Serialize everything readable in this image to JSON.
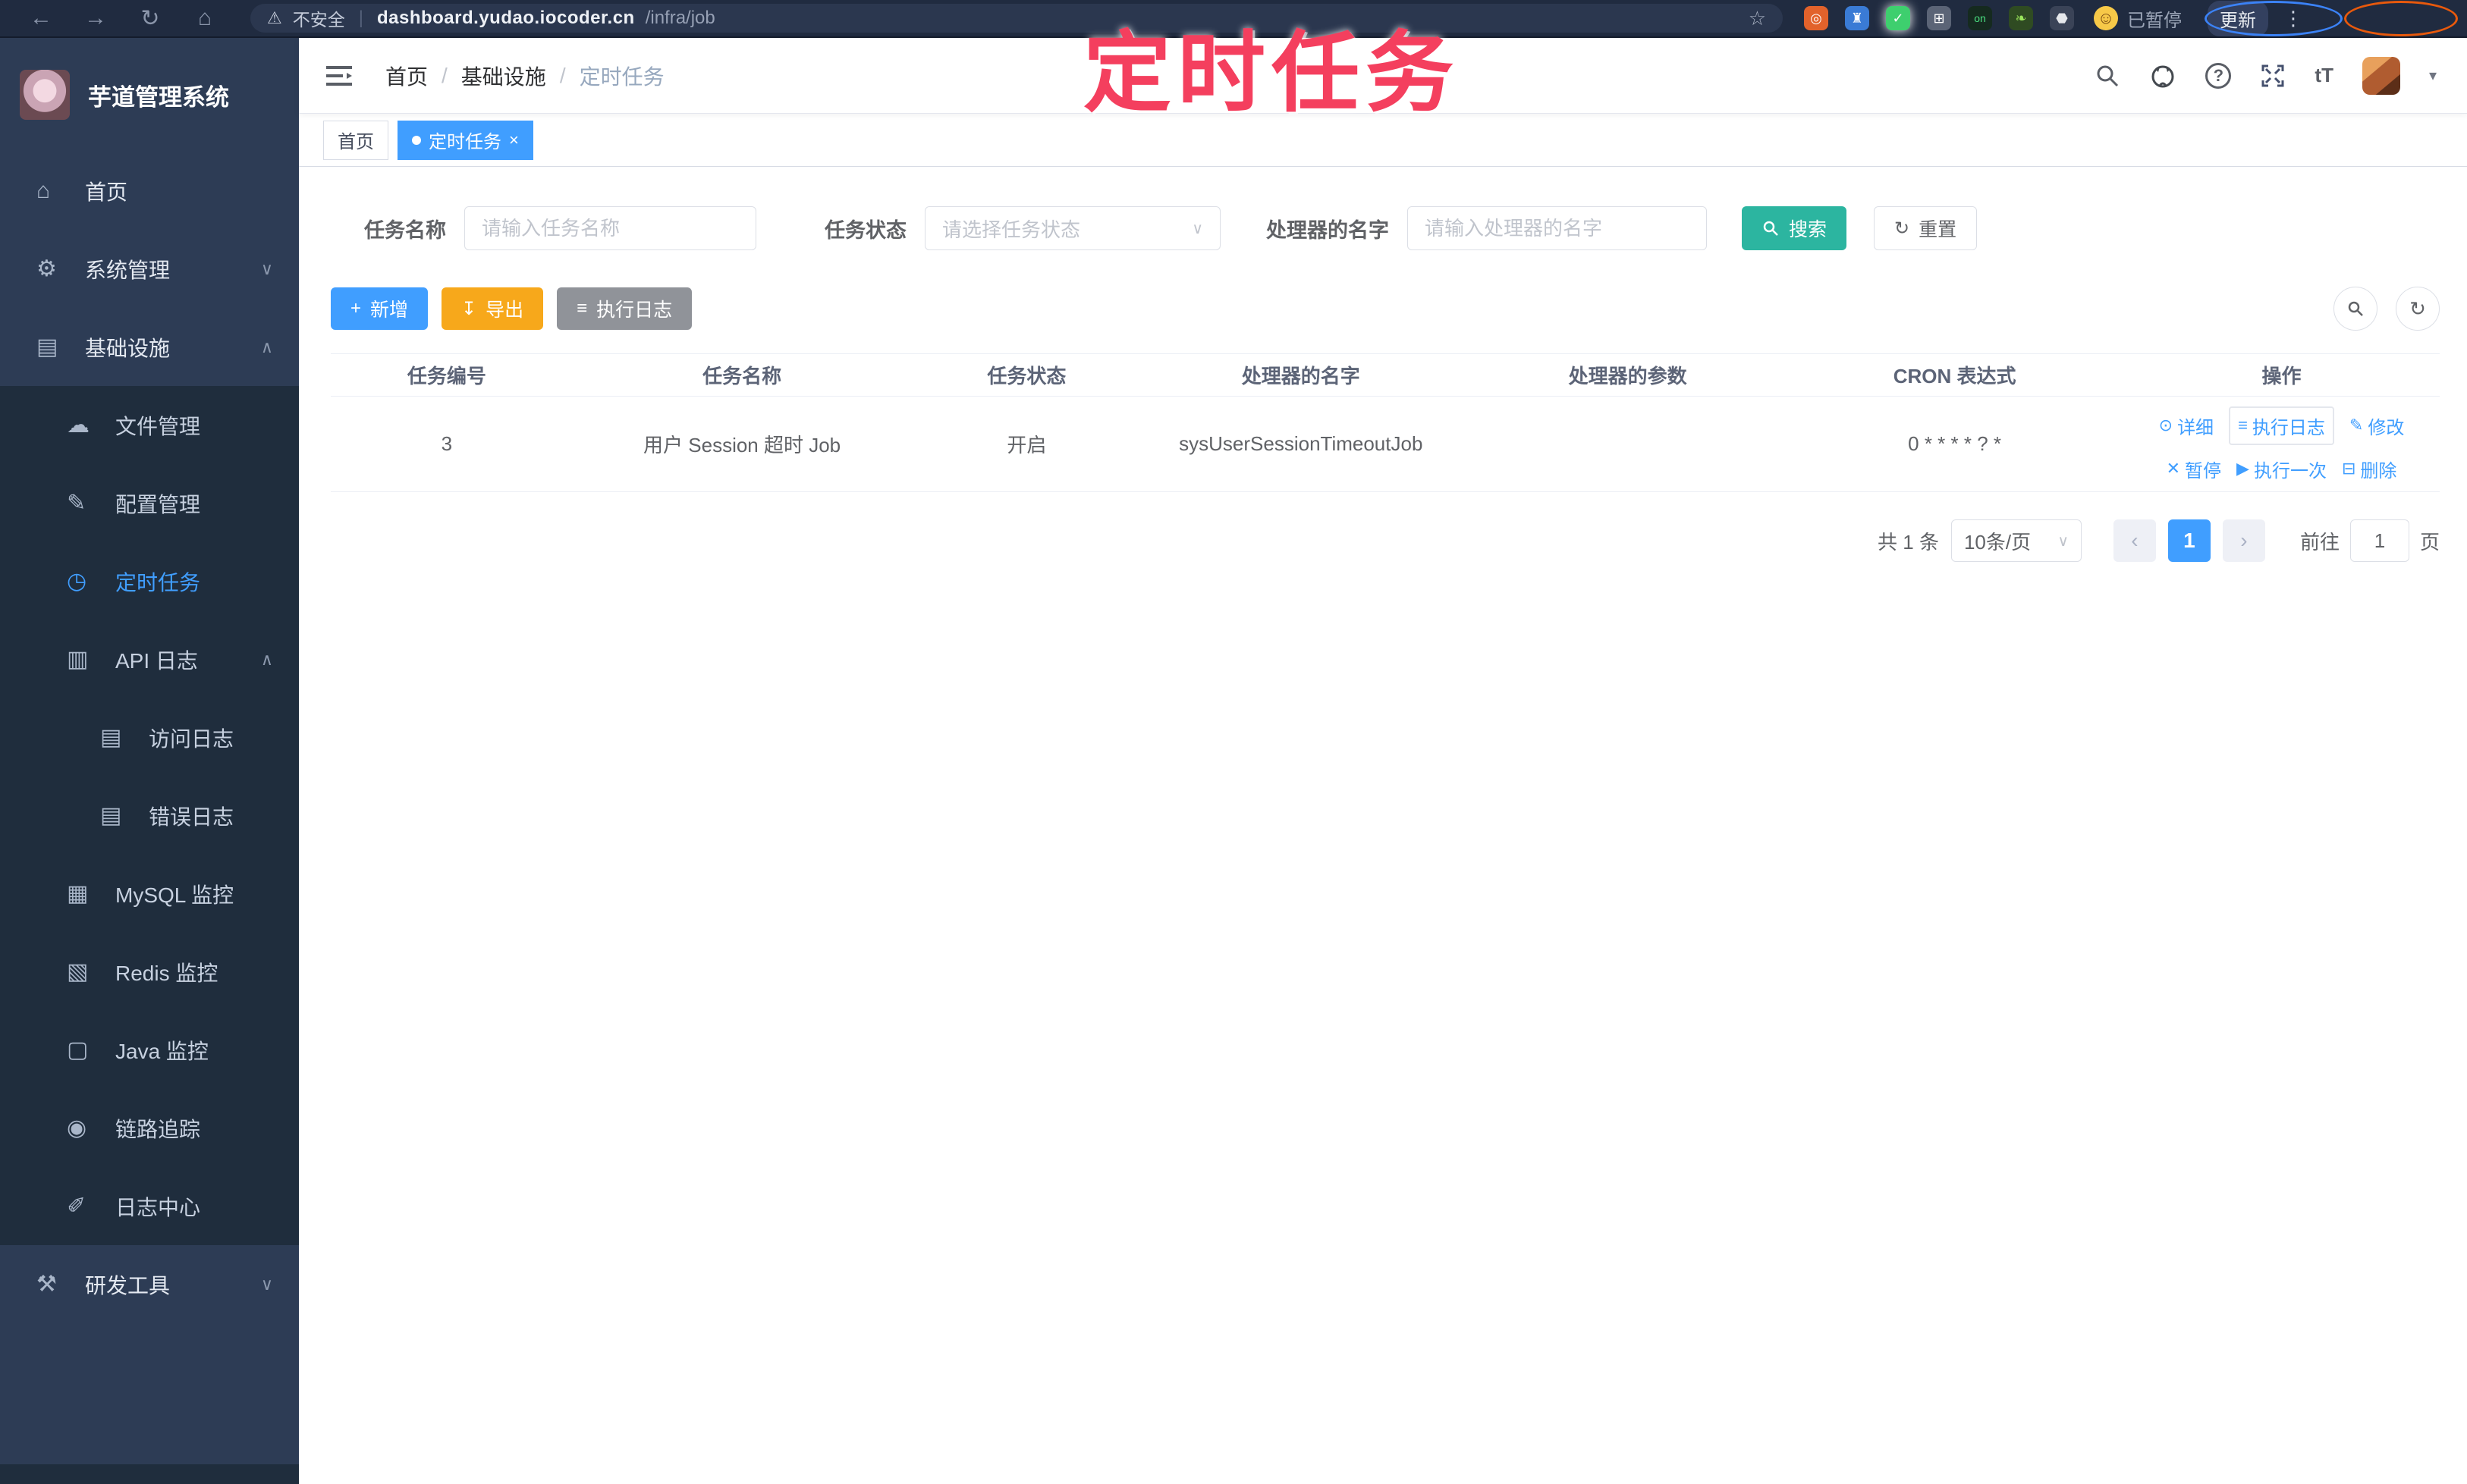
{
  "annotation": {
    "title": "定时任务"
  },
  "browser": {
    "security_label": "不安全",
    "url_host": "dashboard.yudao.iocoder.cn",
    "url_path": "/infra/job",
    "extension_badge": "on",
    "profile_label": "已暂停",
    "update_label": "更新"
  },
  "sidebar": {
    "app_title": "芋道管理系统",
    "items": [
      {
        "label": "首页",
        "glyph": "⌂"
      },
      {
        "label": "系统管理",
        "glyph": "⚙",
        "chevron": "∨"
      },
      {
        "label": "基础设施",
        "glyph": "▤",
        "chevron": "∧"
      },
      {
        "label": "文件管理",
        "glyph": "☁"
      },
      {
        "label": "配置管理",
        "glyph": "✎"
      },
      {
        "label": "定时任务",
        "glyph": "◷"
      },
      {
        "label": "API 日志",
        "glyph": "▥",
        "chevron": "∧"
      },
      {
        "label": "访问日志",
        "glyph": "▤"
      },
      {
        "label": "错误日志",
        "glyph": "▤"
      },
      {
        "label": "MySQL 监控",
        "glyph": "▦"
      },
      {
        "label": "Redis 监控",
        "glyph": "▧"
      },
      {
        "label": "Java 监控",
        "glyph": "▢"
      },
      {
        "label": "链路追踪",
        "glyph": "◉"
      },
      {
        "label": "日志中心",
        "glyph": "✐"
      },
      {
        "label": "研发工具",
        "glyph": "⚒",
        "chevron": "∨"
      }
    ]
  },
  "header": {
    "breadcrumb": [
      "首页",
      "基础设施",
      "定时任务"
    ],
    "separator": "/"
  },
  "tabs": [
    {
      "label": "首页"
    },
    {
      "label": "定时任务",
      "close": "×"
    }
  ],
  "filters": {
    "name_label": "任务名称",
    "name_placeholder": "请输入任务名称",
    "status_label": "任务状态",
    "status_placeholder": "请选择任务状态",
    "handler_label": "处理器的名字",
    "handler_placeholder": "请输入处理器的名字",
    "search_label": "搜索",
    "reset_label": "重置"
  },
  "toolbar": {
    "add_label": "新增",
    "export_label": "导出",
    "exec_log_label": "执行日志"
  },
  "table": {
    "columns": [
      "任务编号",
      "任务名称",
      "任务状态",
      "处理器的名字",
      "处理器的参数",
      "CRON 表达式",
      "操作"
    ],
    "rows": [
      {
        "id": "3",
        "name": "用户 Session 超时 Job",
        "status": "开启",
        "handler": "sysUserSessionTimeoutJob",
        "param": "",
        "cron": "0 * * * * ? *",
        "actions": [
          "详细",
          "执行日志",
          "修改",
          "暂停",
          "执行一次",
          "删除"
        ]
      }
    ]
  },
  "pagination": {
    "total": "共 1 条",
    "page_size": "10条/页",
    "current": "1",
    "goto_label": "前往",
    "goto_value": "1",
    "page_unit": "页"
  },
  "colors": {
    "accent": "#409eff",
    "search_teal": "#2cb5a0",
    "export_orange": "#f7a81b",
    "info_gray": "#909399",
    "annotation_pink": "#f43f5e",
    "sidebar_bg": "#2d3c55",
    "submenu_bg": "#1f2d3d"
  }
}
